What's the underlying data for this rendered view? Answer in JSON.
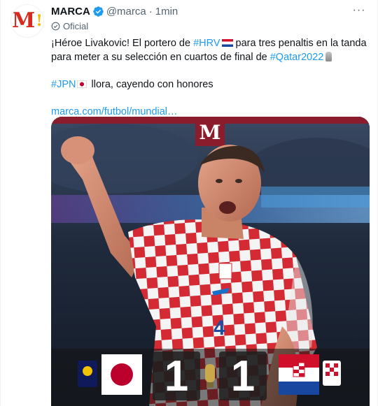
{
  "tweet": {
    "author_name": "MARCA",
    "handle": "@marca",
    "separator": "·",
    "time": "1min",
    "more_label": "···",
    "official_label": "Oficial",
    "text": {
      "line1_prefix": "¡Héroe Livakovic! El portero de ",
      "hashtag_hrv": "#HRV",
      "line1_suffix": "  para tres penaltis en la tanda para meter a su selección en cuartos de final de ",
      "hashtag_qatar": "#Qatar2022",
      "hashtag_jpn": "#JPN",
      "line2_suffix": " llora, cayendo con honores",
      "link": "marca.com/futbol/mundial…"
    }
  },
  "media": {
    "brand_letter": "M",
    "score_home": "1",
    "score_away": "1",
    "player_number": "4"
  },
  "colors": {
    "brand_red": "#d52b1e",
    "brand_maroon": "#8a1c2b",
    "link_blue": "#1d9bf0",
    "verified_blue": "#1d9bf0",
    "muted_gray": "#536471"
  }
}
